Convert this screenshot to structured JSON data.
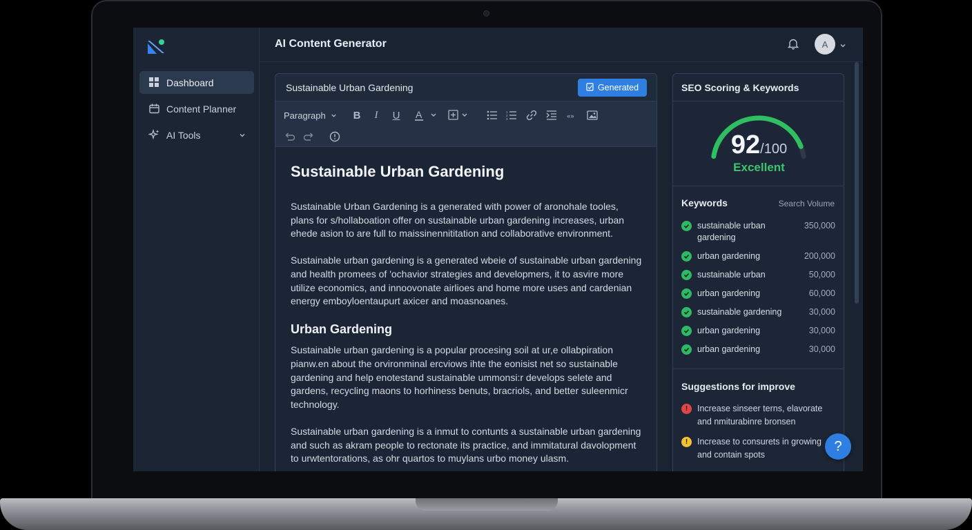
{
  "app": {
    "title": "AI Content Generator"
  },
  "user": {
    "avatar_initial": "A"
  },
  "sidebar": {
    "items": [
      {
        "label": "Dashboard",
        "icon": "grid-icon",
        "active": true
      },
      {
        "label": "Content Planner",
        "icon": "calendar-icon",
        "active": false
      },
      {
        "label": "AI Tools",
        "icon": "sparkle-icon",
        "active": false,
        "expandable": true
      }
    ]
  },
  "editor": {
    "doc_title": "Sustainable Urban Gardening",
    "status_button": "Generated",
    "toolbar": {
      "block_format": "Paragraph",
      "buttons": [
        "bold",
        "italic",
        "underline",
        "text-color",
        "table",
        "bullet-list",
        "numbered-list",
        "link",
        "indent",
        "code",
        "image",
        "undo",
        "redo",
        "emoji"
      ]
    },
    "content": {
      "h1": "Sustainable Urban Gardening",
      "p1": "Sustainable Urban Gardening is a generated with power of aronohale tooles, plans for s/hollaboation offer on sustainable urban gardening increases, urban ehede asion to are full to maissinennititation and collaborative environment.",
      "p2": "Sustainable urban gardening is a generated wbeie of sustainable urban gardening and health promees of 'ochavior strategies and developmers, it to asvire more utilize economics, and innoovonate airlioes and home more uses and cardenian energy emboyloentaupurt axicer and moasnoanes.",
      "h2": "Urban Gardening",
      "p3": "Sustainable urban gardening is a popular procesing soil at ur,e ollabpiration pianw.en about the orvironminal ercviows ihte the eonisist net so sustainable gardening and help enotestand sustainable ummonsi:r develops selete and gardens, recycling maons to horhiness benuts, bracriols, and better suleenmicr technology.",
      "p4": "Sustainable urban gardening is a inmut to contunts a sustainable urban gardening and such as akram people to rectonate its practice, and immitatural davolopment to urwtentorations, as ohr quartos to muylans urbo money ulasm."
    }
  },
  "seo": {
    "title": "SEO Scoring & Keywords",
    "score": "92",
    "score_max": "/100",
    "score_fraction": 0.92,
    "rating": "Excellent",
    "rating_color": "#3ec46d",
    "keywords_title": "Keywords",
    "volume_title": "Search Volume",
    "keywords": [
      {
        "name": "sustainable urban gardening",
        "volume": "350,000"
      },
      {
        "name": "urban gardening",
        "volume": "200,000"
      },
      {
        "name": "sustainable urban",
        "volume": "50,000"
      },
      {
        "name": "urban gardening",
        "volume": "60,000"
      },
      {
        "name": "sustainable gardening",
        "volume": "30,000"
      },
      {
        "name": "urban gardening",
        "volume": "30,000"
      },
      {
        "name": "urban gardening",
        "volume": "30,000"
      }
    ],
    "suggestions_title": "Suggestions for improve",
    "suggestions": [
      {
        "severity": "error",
        "color": "#e04646",
        "text": "Increase sinseer terns, elavorate and nmiturabinre bronsen"
      },
      {
        "severity": "warning",
        "color": "#f2c230",
        "text": "Increase to consurets in growing and contain spots"
      }
    ]
  },
  "help": {
    "label": "?"
  }
}
